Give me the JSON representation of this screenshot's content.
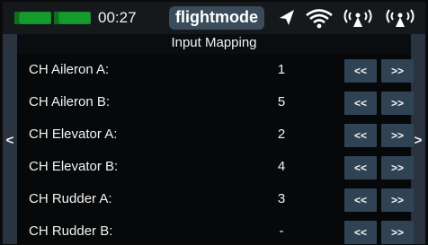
{
  "status": {
    "time": "00:27",
    "mode": "flightmode",
    "icons": [
      "battery-icon",
      "battery-icon",
      "navigation-arrow-icon",
      "wifi-icon",
      "rssi-antenna-icon",
      "rssi-antenna-icon"
    ],
    "battery_color": "#139b2b"
  },
  "title": "Input Mapping",
  "nav": {
    "prev": "<",
    "next": ">"
  },
  "rows": [
    {
      "label": "CH Aileron A:",
      "value": "1",
      "prev": "<<",
      "next": ">>"
    },
    {
      "label": "CH Aileron B:",
      "value": "5",
      "prev": "<<",
      "next": ">>"
    },
    {
      "label": "CH Elevator A:",
      "value": "2",
      "prev": "<<",
      "next": ">>"
    },
    {
      "label": "CH Elevator B:",
      "value": "4",
      "prev": "<<",
      "next": ">>"
    },
    {
      "label": "CH Rudder A:",
      "value": "3",
      "prev": "<<",
      "next": ">>"
    },
    {
      "label": "CH Rudder B:",
      "value": "-",
      "prev": "<<",
      "next": ">>"
    }
  ],
  "colors": {
    "button": "#2f4354",
    "pill": "#3a4c5c",
    "side": "#2a3440"
  }
}
